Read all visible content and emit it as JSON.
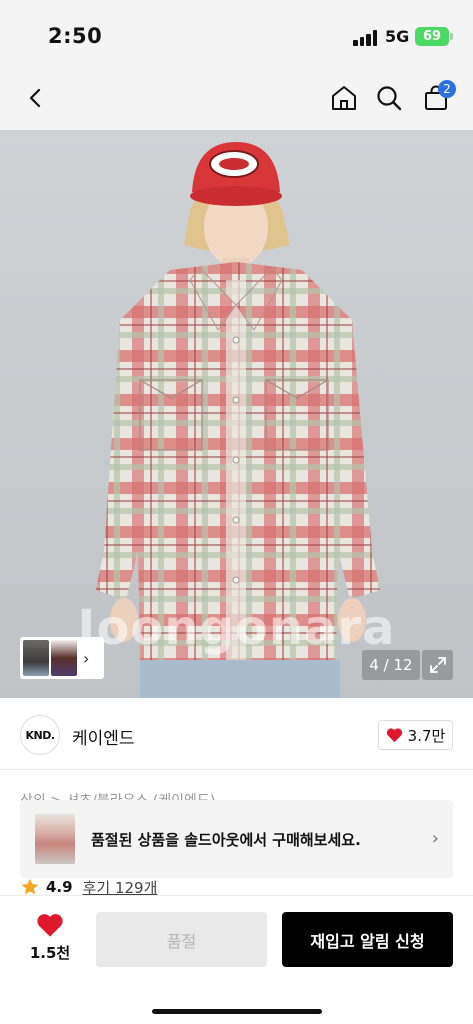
{
  "status": {
    "time": "2:50",
    "network": "5G",
    "battery": "69"
  },
  "nav": {
    "cart_count": "2"
  },
  "image": {
    "watermark": "Joongonara",
    "counter": "4 / 12"
  },
  "brand": {
    "logo_text": "KND.",
    "name": "케이엔드",
    "likes": "3.7만"
  },
  "breadcrumb": "상의 > 셔츠/블라우스 (케이엔드)",
  "soldout_banner": {
    "text": "품절된 상품을 솔드아웃에서 구매해보세요."
  },
  "rating": {
    "score": "4.9",
    "reviews": "후기 129개"
  },
  "bottom": {
    "wish_count": "1.5천",
    "soldout_label": "품절",
    "restock_label": "재입고 알림 신청"
  },
  "colors": {
    "heart": "#e0182d",
    "star": "#f5a623",
    "badge": "#2f6fe4"
  }
}
